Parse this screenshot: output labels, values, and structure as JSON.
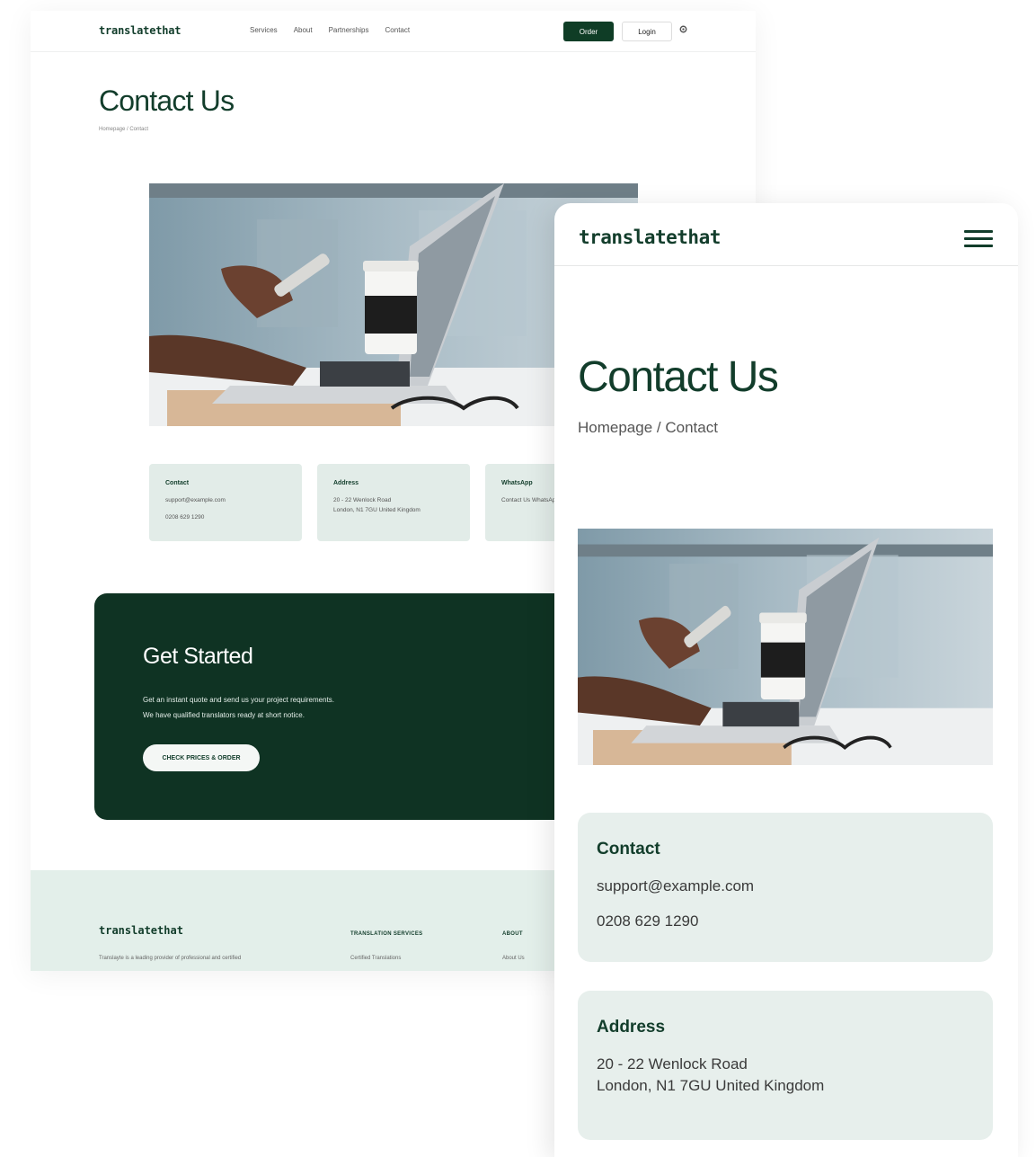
{
  "brand": "translatethat",
  "desktop": {
    "nav": {
      "links": [
        "Services",
        "About",
        "Partnerships",
        "Contact"
      ],
      "order_label": "Order",
      "login_label": "Login",
      "settings_icon": "gear-icon"
    },
    "title": "Contact Us",
    "breadcrumb": "Homepage / Contact",
    "cards": [
      {
        "title": "Contact",
        "line1": "support@example.com",
        "line2": "0208 629 1290"
      },
      {
        "title": "Address",
        "line1": "20 - 22 Wenlock Road",
        "line2": "London, N1 7GU United Kingdom"
      },
      {
        "title": "WhatsApp",
        "line1": "Contact Us WhatsApp"
      }
    ],
    "cta": {
      "title": "Get Started",
      "line1": "Get an instant quote and send us your project requirements.",
      "line2": "We have qualified translators ready at short notice.",
      "button": "CHECK PRICES & ORDER"
    },
    "footer": {
      "description": "Translayte is a leading provider of professional and certified",
      "col1_heading": "TRANSLATION SERVICES",
      "col1_item": "Certified Translations",
      "col2_heading": "ABOUT",
      "col2_item": "About Us"
    }
  },
  "mobile": {
    "title": "Contact Us",
    "breadcrumb": "Homepage / Contact",
    "menu_icon": "hamburger-menu-icon",
    "cards": [
      {
        "title": "Contact",
        "line1": "support@example.com",
        "line2": "0208 629 1290"
      },
      {
        "title": "Address",
        "line1": "20 - 22 Wenlock Road",
        "line2": "London, N1 7GU United Kingdom"
      }
    ]
  },
  "colors": {
    "brand_dark": "#123d2b",
    "cta_bg": "#0f3323",
    "card_bg": "#e2ece8",
    "footer_bg": "#e3efea"
  }
}
